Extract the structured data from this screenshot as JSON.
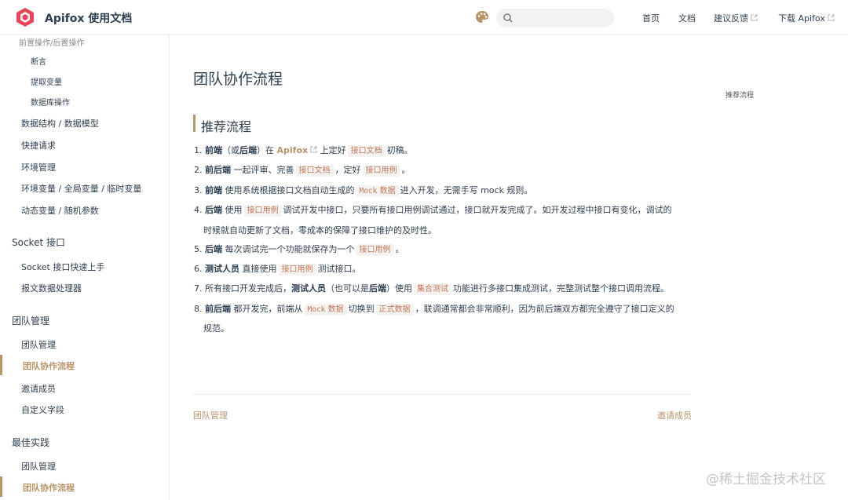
{
  "header": {
    "brand": "Apifox 使用文档",
    "search_placeholder": "",
    "nav": {
      "home": "首页",
      "docs": "文档",
      "feedback": "建议反馈",
      "download": "下载 Apifox"
    }
  },
  "sidebar": {
    "top_item": "前置操作/后置操作",
    "sub_items": [
      "断言",
      "提取变量",
      "数据库操作"
    ],
    "items_a": [
      "数据结构 / 数据模型",
      "快捷请求",
      "环境管理",
      "环境变量 / 全局变量 / 临时变量",
      "动态变量 / 随机参数"
    ],
    "group_socket": "Socket 接口",
    "items_socket": [
      "Socket 接口快速上手",
      "报文数据处理器"
    ],
    "group_team": "团队管理",
    "items_team": [
      "团队管理",
      "团队协作流程",
      "邀请成员",
      "自定义字段"
    ],
    "group_best": "最佳实践",
    "items_best": [
      "团队管理",
      "团队协作流程"
    ]
  },
  "content": {
    "title": "团队协作流程",
    "section": "推荐流程",
    "toc": "推荐流程",
    "steps": {
      "s1": {
        "n": "1.",
        "a": "前端",
        "b": "（或",
        "c": "后端",
        "d": "）在",
        "link": "Apifox",
        "e": "上定好",
        "code1": "接口文档",
        "f": "初稿。"
      },
      "s2": {
        "n": "2.",
        "a": "前后端",
        "b": "一起评审、完善",
        "code1": "接口文档",
        "c": "，定好",
        "code2": "接口用例",
        "d": "。"
      },
      "s3": {
        "n": "3.",
        "a": "前端",
        "b": "使用系统根据接口文档自动生成的",
        "code1a": "Mock",
        "code1b": "数据",
        "c": "进入开发，无需手写 mock 规则。"
      },
      "s4": {
        "n": "4.",
        "a": "后端",
        "b": "使用",
        "code1": "接口用例",
        "c": "调试开发中接口，只要所有接口用例调试通过，接口就开发完成了。如开发过程中接口有变化，调试的",
        "d": "时候就自动更新了文档，零成本的保障了接口维护的及时性。"
      },
      "s5": {
        "n": "5.",
        "a": "后端",
        "b": "每次调试完一个功能就保存为一个",
        "code1": "接口用例",
        "c": "。"
      },
      "s6": {
        "n": "6.",
        "a": "测试人员",
        "b": "直接使用",
        "code1": "接口用例",
        "c": "测试接口。"
      },
      "s7": {
        "n": "7.",
        "a": "所有接口开发完成后，",
        "b": "测试人员",
        "c": "（也可以是",
        "d": "后端",
        "e": "）使用",
        "code1": "集合测试",
        "f": "功能进行多接口集成测试，完整测试整个接口调用流程。"
      },
      "s8": {
        "n": "8.",
        "a": "前后端",
        "b": "都开发完，前端从",
        "code1a": "Mock",
        "code1b": "数据",
        "c": "切换到",
        "code2": "正式数据",
        "d": "，联调通常都会非常顺利，因为前后端双方都完全遵守了接口定义的",
        "e": "规范。"
      }
    },
    "prev": "团队管理",
    "next": "邀请成员"
  },
  "watermark": "@稀土掘金技术社区",
  "colors": {
    "accent": "#b8946a",
    "code_text": "#c0765a",
    "code_bg": "#f5f3f0"
  }
}
